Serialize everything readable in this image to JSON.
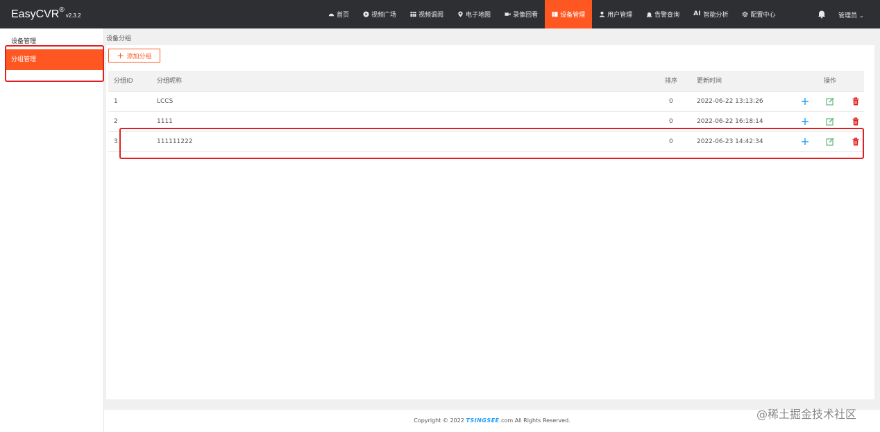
{
  "app": {
    "brand": "EasyCVR",
    "registered": "®",
    "version": "v2.3.2"
  },
  "nav": [
    {
      "label": "首页",
      "icon": "dashboard-icon",
      "active": false
    },
    {
      "label": "视频广场",
      "icon": "play-circle-icon",
      "active": false
    },
    {
      "label": "视频调阅",
      "icon": "grid-icon",
      "active": false
    },
    {
      "label": "电子地图",
      "icon": "map-pin-icon",
      "active": false
    },
    {
      "label": "录像回看",
      "icon": "video-camera-icon",
      "active": false
    },
    {
      "label": "设备管理",
      "icon": "device-icon",
      "active": true
    },
    {
      "label": "用户管理",
      "icon": "user-icon",
      "active": false
    },
    {
      "label": "告警查询",
      "icon": "alarm-icon",
      "active": false
    },
    {
      "label": "智能分析",
      "icon": "ai-icon",
      "icon_text": "AI",
      "active": false
    },
    {
      "label": "配置中心",
      "icon": "gear-icon",
      "active": false
    }
  ],
  "user": {
    "label": "管理员",
    "caret": "⌄"
  },
  "sidebar": {
    "title": "设备管理",
    "items": [
      {
        "label": "分组管理",
        "active": true
      }
    ]
  },
  "page": {
    "breadcrumb": "设备分组",
    "add_button": "添加分组",
    "add_icon": "+"
  },
  "table": {
    "headers": {
      "id": "分组ID",
      "name": "分组昵称",
      "sort": "排序",
      "time": "更新时间",
      "ops": "操作"
    },
    "rows": [
      {
        "id": "1",
        "name": "LCCS",
        "sort": "0",
        "time": "2022-06-22 13:13:26"
      },
      {
        "id": "2",
        "name": "1111",
        "sort": "0",
        "time": "2022-06-22 16:18:14"
      },
      {
        "id": "3",
        "name": "111111222",
        "sort": "0",
        "time": "2022-06-23 14:42:34"
      }
    ]
  },
  "footer": {
    "prefix": "Copyright © 2022",
    "logo_text": "TSINGSEE",
    "suffix": ".com All Rights Reserved."
  },
  "watermark": "@稀土掘金技术社区",
  "colors": {
    "topbar": "#2e2f33",
    "accent": "#ff5722",
    "add": "#1e9fff",
    "edit": "#5fb878",
    "delete": "#e02020",
    "highlight": "#e02020"
  }
}
